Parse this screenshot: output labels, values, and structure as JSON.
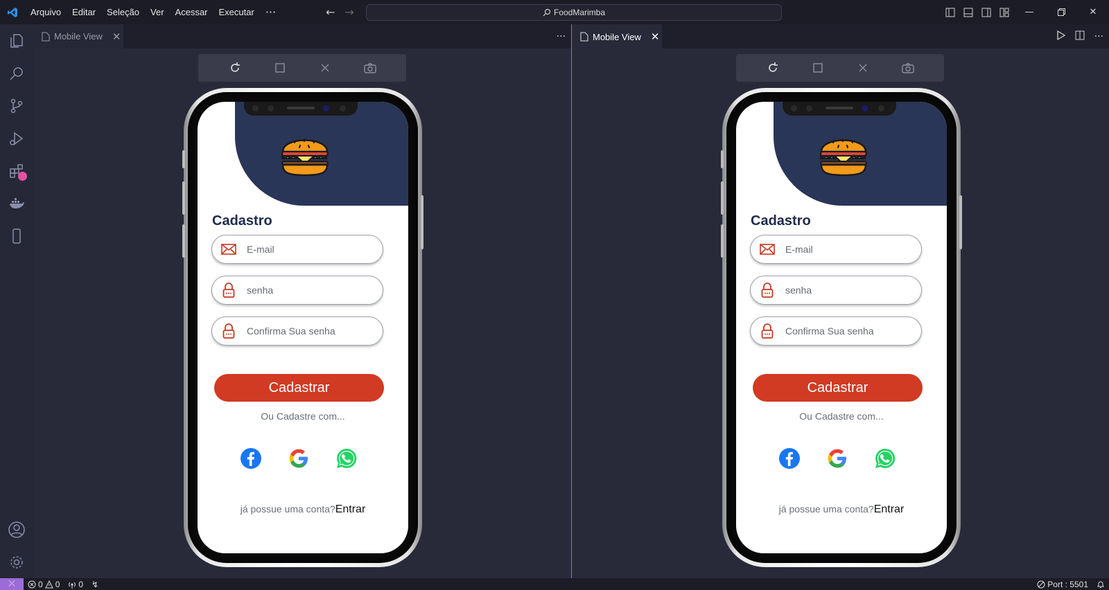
{
  "titlebar": {
    "menu": [
      "Arquivo",
      "Editar",
      "Seleção",
      "Ver",
      "Acessar",
      "Executar"
    ],
    "more": "···",
    "search": "FoodMarimba"
  },
  "editor": {
    "left_tab": "Mobile View",
    "right_tab": "Mobile View",
    "more": "···"
  },
  "app": {
    "title": "Cadastro",
    "email_placeholder": "E-mail",
    "password_placeholder": "senha",
    "confirm_placeholder": "Confirma Sua senha",
    "submit": "Cadastrar",
    "or_text": "Ou Cadastre com...",
    "footer_text": "já possue uma conta?",
    "footer_link": "Entrar",
    "colors": {
      "hero": "#2a3657",
      "primary": "#d13a23",
      "title": "#1f2b4d"
    },
    "social": [
      "facebook-icon",
      "google-icon",
      "whatsapp-icon"
    ]
  },
  "statusbar": {
    "errors": "0",
    "warnings": "0",
    "ports": "0",
    "port_label": "Port : 5501"
  }
}
